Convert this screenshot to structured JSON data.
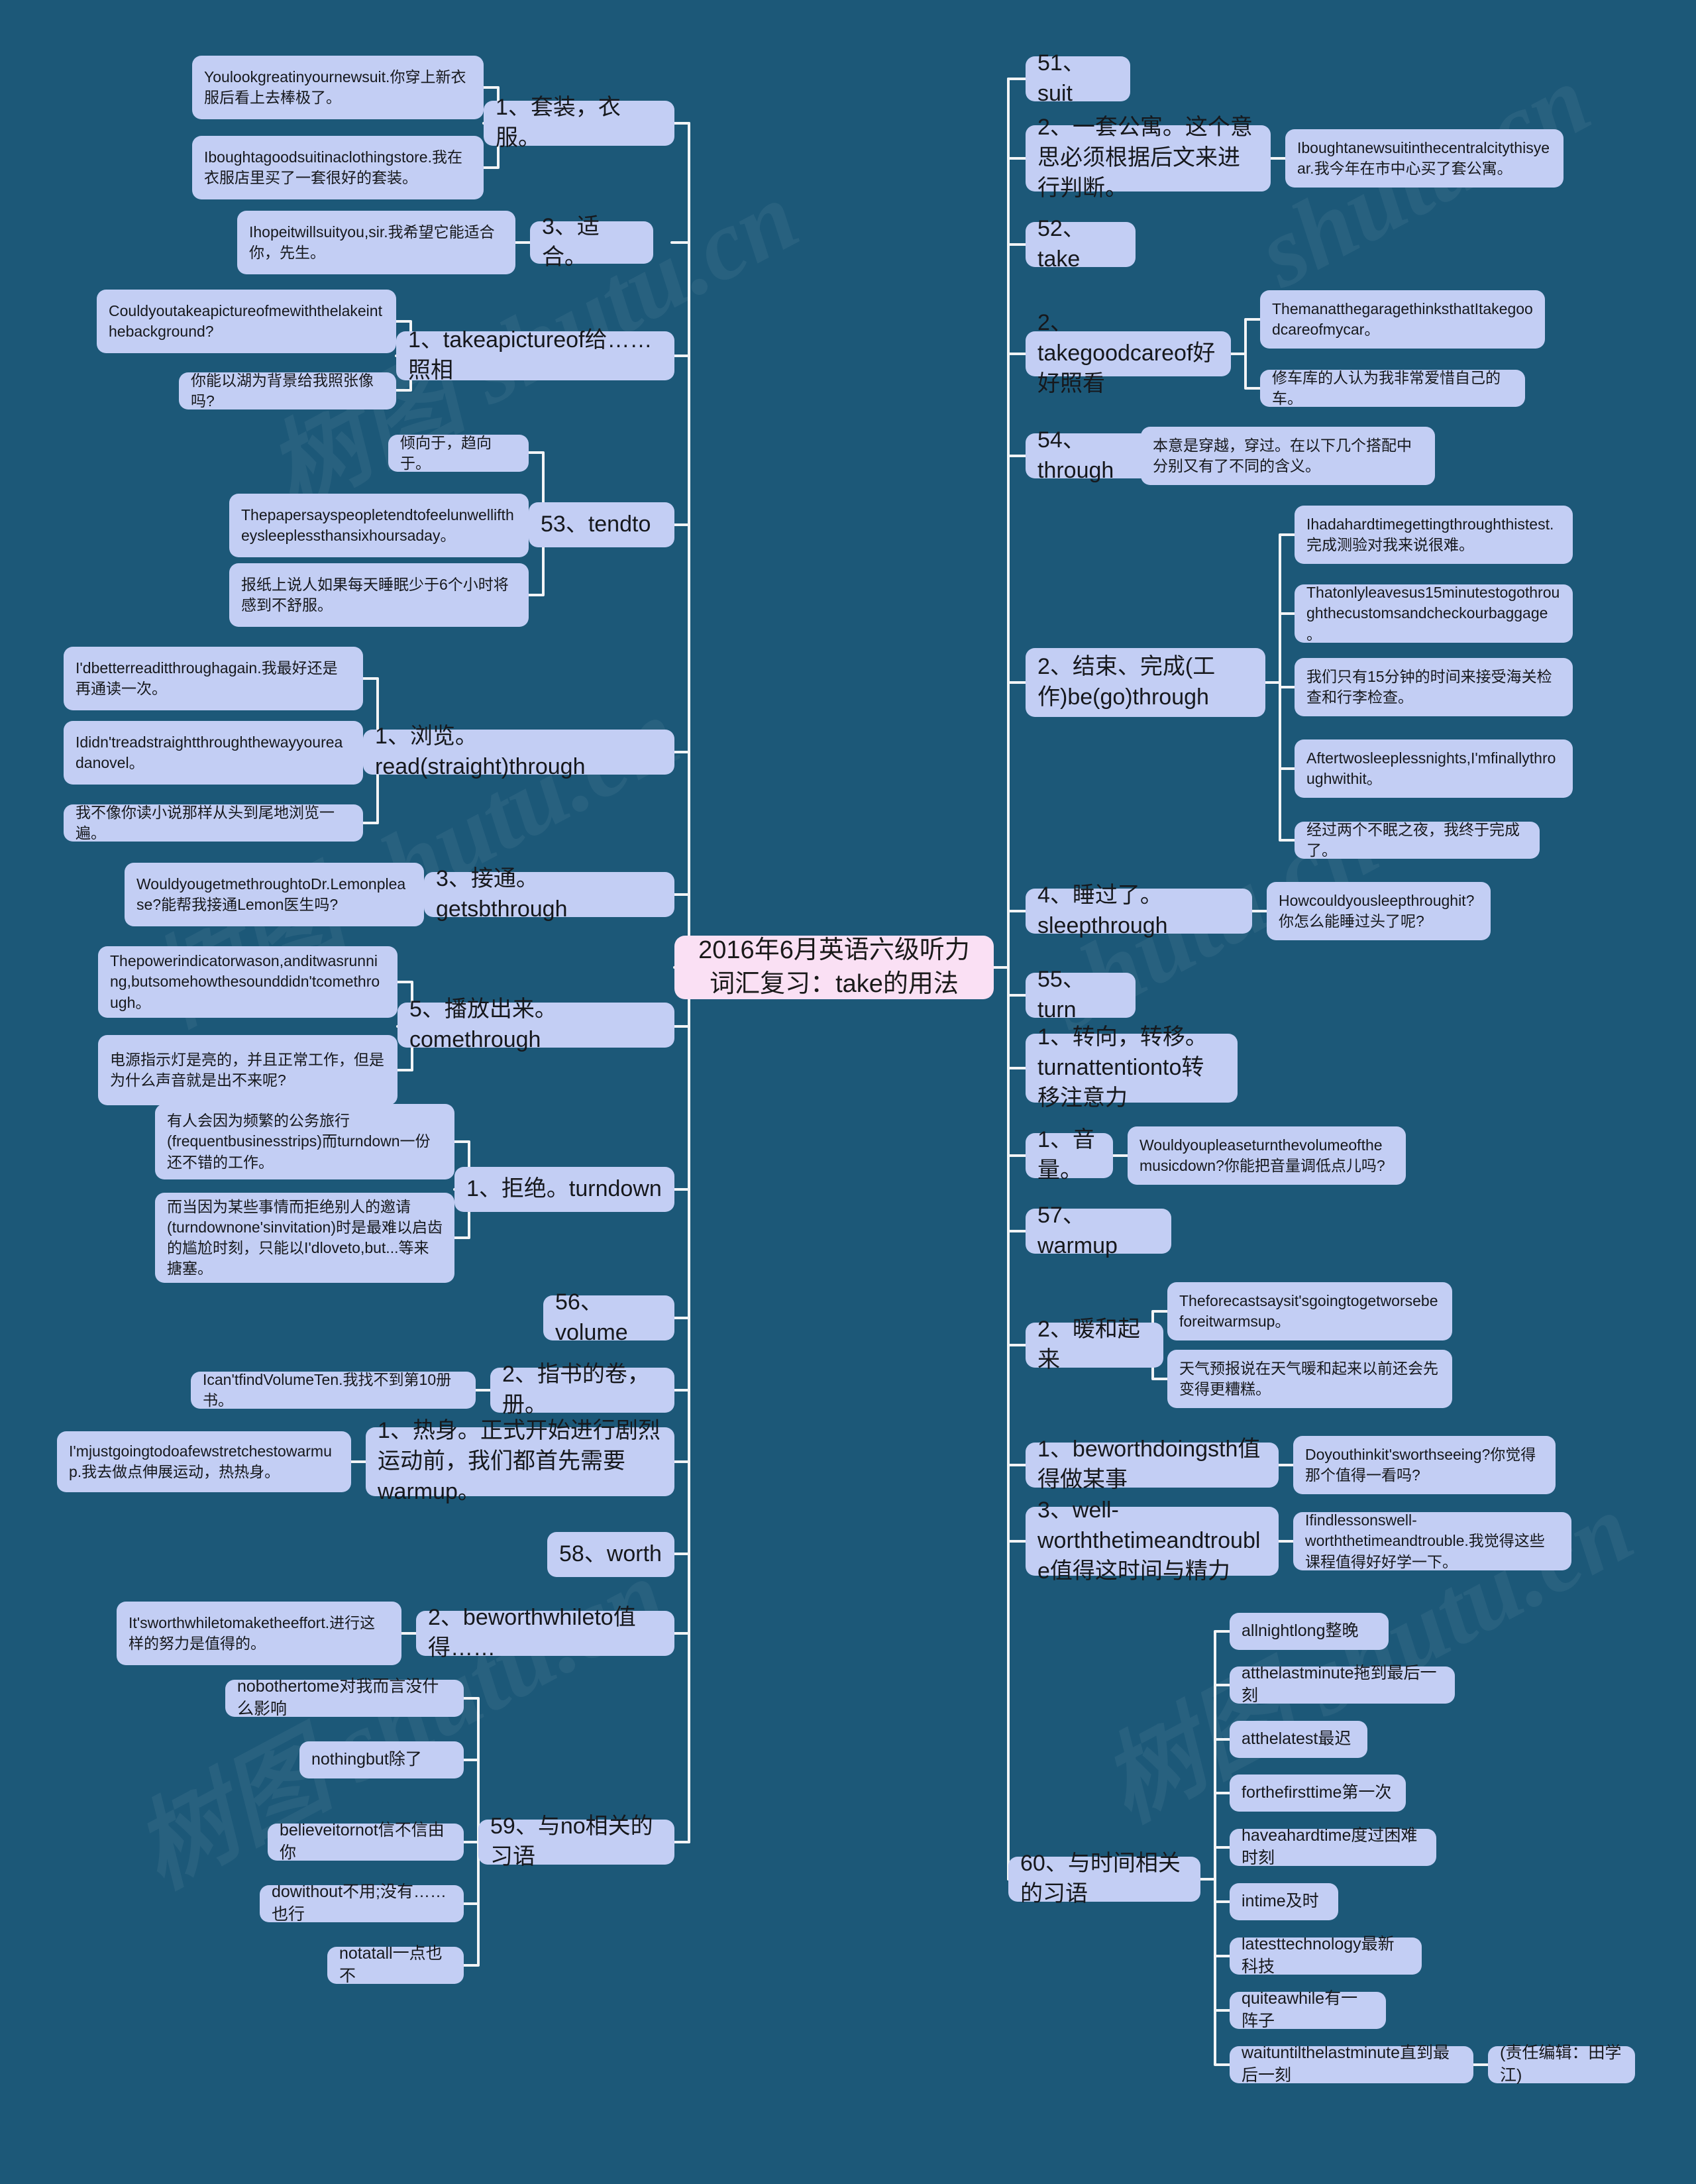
{
  "meta": {
    "background_color": "#1c5878",
    "node_color": "#c3cef4",
    "center_color": "#fae0f4",
    "link_color": "#f2f4f6"
  },
  "center": {
    "title": "2016年6月英语六级听力词汇复习：take的用法"
  },
  "watermarks": [
    "树图 shutu.cn",
    "树图 shutu.cn",
    "树图 shutu.cn",
    "shutu.cn",
    "shutu.cn",
    "树图 shutu.cn"
  ],
  "left_branches": [
    {
      "id": "suit-1",
      "label": "1、套装，衣服。",
      "children": [
        "Youlookgreatinyournewsuit.你穿上新衣服后看上去棒极了。",
        "Iboughtagoodsuitinaclothingstore.我在衣服店里买了一套很好的套装。"
      ]
    },
    {
      "id": "suit-3",
      "label": "3、适合。",
      "children": [
        "Ihopeitwillsuityou,sir.我希望它能适合你，先生。"
      ]
    },
    {
      "id": "take-picture",
      "label": "1、takeapictureof给……照相",
      "children": [
        "Couldyoutakeapictureofmewiththelakeinthebackground?",
        "你能以湖为背景给我照张像吗?"
      ]
    },
    {
      "id": "tendto",
      "label": "53、tendto",
      "children": [
        "倾向于，趋向于。",
        "Thepapersayspeopletendtofeelunwelliftheysleeplessthansixhoursaday。",
        "报纸上说人如果每天睡眠少于6个小时将感到不舒服。"
      ]
    },
    {
      "id": "readthrough",
      "label": "1、浏览。read(straight)through",
      "children": [
        "I'dbetterreaditthroughagain.我最好还是再通读一次。",
        "Ididn'treadstraightthroughthewayyoureadanovel。",
        "我不像你读小说那样从头到尾地浏览一遍。"
      ]
    },
    {
      "id": "getsbthrough",
      "label": "3、接通。getsbthrough",
      "children": [
        "WouldyougetmethroughtoDr.Lemonplease?能帮我接通Lemon医生吗?"
      ]
    },
    {
      "id": "comethrough",
      "label": "5、播放出来。comethrough",
      "children": [
        "Thepowerindicatorwason,anditwasrunning,butsomehowthesounddidn'tcomethrough。",
        "电源指示灯是亮的，并且正常工作，但是为什么声音就是出不来呢?"
      ]
    },
    {
      "id": "turndown",
      "label": "1、拒绝。turndown",
      "children": [
        "有人会因为频繁的公务旅行(frequentbusinesstrips)而turndown一份还不错的工作。",
        "而当因为某些事情而拒绝别人的邀请(turndownone'sinvitation)时是最难以启齿的尴尬时刻，只能以I'dloveto,but...等来搪塞。"
      ]
    },
    {
      "id": "volume",
      "label": "56、volume",
      "children": []
    },
    {
      "id": "volume-2",
      "label": "2、指书的卷，册。",
      "children": [
        "Ican'tfindVolumeTen.我找不到第10册书。"
      ]
    },
    {
      "id": "warmup-1",
      "label": "1、热身。正式开始进行剧烈运动前，我们都首先需要warmup。",
      "children": [
        "I'mjustgoingtodoafewstretchestowarmup.我去做点伸展运动，热热身。"
      ]
    },
    {
      "id": "worth",
      "label": "58、worth",
      "children": []
    },
    {
      "id": "beworthwhileto",
      "label": "2、beworthwhileto值得……",
      "children": [
        "It'sworthwhiletomaketheeffort.进行这样的努力是值得的。"
      ]
    },
    {
      "id": "no-idioms",
      "label": "59、与no相关的习语",
      "children": [
        "nobothertome对我而言没什么影响",
        "nothingbut除了",
        "believeitornot信不信由你",
        "dowithout不用;没有……也行",
        "notatall一点也不"
      ]
    }
  ],
  "right_branches": [
    {
      "id": "r-suit",
      "label": "51、suit",
      "children": []
    },
    {
      "id": "r-suit-2",
      "label": "2、一套公寓。这个意思必须根据后文来进行判断。",
      "children": [
        "Iboughtanewsuitinthecentralcitythisyear.我今年在市中心买了套公寓。"
      ]
    },
    {
      "id": "r-take",
      "label": "52、take",
      "children": []
    },
    {
      "id": "r-takegoodcareof",
      "label": "2、takegoodcareof好好照看",
      "children": [
        "ThemanatthegaragethinksthatItakegoodcareofmycar。",
        "修车库的人认为我非常爱惜自己的车。"
      ]
    },
    {
      "id": "r-through",
      "label": "54、through",
      "children": [
        "本意是穿越，穿过。在以下几个搭配中分别又有了不同的含义。"
      ]
    },
    {
      "id": "r-begothrough",
      "label": "2、结束、完成(工作)be(go)through",
      "children": [
        "Ihadahardtimegettingthroughthistest.完成测验对我来说很难。",
        "Thatonlyleavesus15minutestogothroughthecustomsandcheckourbaggage。",
        "我们只有15分钟的时间来接受海关检查和行李检查。",
        "Aftertwosleeplessnights,I'mfinallythroughwithit。",
        "经过两个不眠之夜，我终于完成了。"
      ]
    },
    {
      "id": "r-sleepthrough",
      "label": "4、睡过了。sleepthrough",
      "children": [
        "Howcouldyousleepthroughit?你怎么能睡过头了呢?"
      ]
    },
    {
      "id": "r-turn",
      "label": "55、turn",
      "children": []
    },
    {
      "id": "r-turnattention",
      "label": "1、转向，转移。turnattentionto转移注意力",
      "children": []
    },
    {
      "id": "r-volume-1",
      "label": "1、音量。",
      "children": [
        "Wouldyoupleaseturnthevolumeofthemusicdown?你能把音量调低点儿吗?"
      ]
    },
    {
      "id": "r-warmup",
      "label": "57、warmup",
      "children": []
    },
    {
      "id": "r-warm",
      "label": "2、暖和起来",
      "children": [
        "Theforecastsaysit'sgoingtogetworsebeforeitwarmsup。",
        "天气预报说在天气暖和起来以前还会先变得更糟糕。"
      ]
    },
    {
      "id": "r-beworthdoing",
      "label": "1、beworthdoingsth值得做某事",
      "children": [
        "Doyouthinkit'sworthseeing?你觉得那个值得一看吗?"
      ]
    },
    {
      "id": "r-wellworth",
      "label": "3、well-worththetimeandtrouble值得这时间与精力",
      "children": [
        "Ifindlessonswell-worththetimeandtrouble.我觉得这些课程值得好好学一下。"
      ]
    },
    {
      "id": "r-time-idioms",
      "label": "60、与时间相关的习语",
      "children": [
        "allnightlong整晚",
        "atthelastminute拖到最后一刻",
        "atthelatest最迟",
        "forthefirsttime第一次",
        "haveahardtime度过困难时刻",
        "intime及时",
        "latesttechnology最新科技",
        "quiteawhile有一阵子",
        "waituntilthelastminute直到最后一刻"
      ]
    }
  ],
  "footer": {
    "editor": "(责任编辑：田学江)"
  }
}
